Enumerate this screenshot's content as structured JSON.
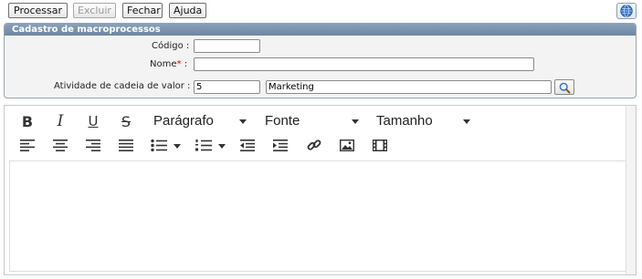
{
  "toolbar": {
    "processar": "Processar",
    "excluir": "Excluir",
    "fechar": "Fechar",
    "ajuda": "Ajuda",
    "help_icon": "globe-help-icon"
  },
  "panel": {
    "title": "Cadastro de macroprocessos",
    "codigo_label": "Código :",
    "codigo_value": "",
    "nome_label": "Nome",
    "nome_required": "*",
    "nome_colon": ":",
    "nome_value": "",
    "atividade_label": "Atividade de cadeia de valor :",
    "atividade_code": "5",
    "atividade_name": "Marketing",
    "lookup_icon": "search-icon"
  },
  "editor": {
    "bold": "B",
    "italic": "I",
    "underline": "U",
    "strike": "S",
    "paragraph_select": "Parágrafo",
    "font_select": "Fonte",
    "size_select": "Tamanho",
    "content": ""
  },
  "colors": {
    "panel_header": "#7a90aa",
    "required": "#dd0000",
    "panel_bg": "#f3f3f3"
  }
}
